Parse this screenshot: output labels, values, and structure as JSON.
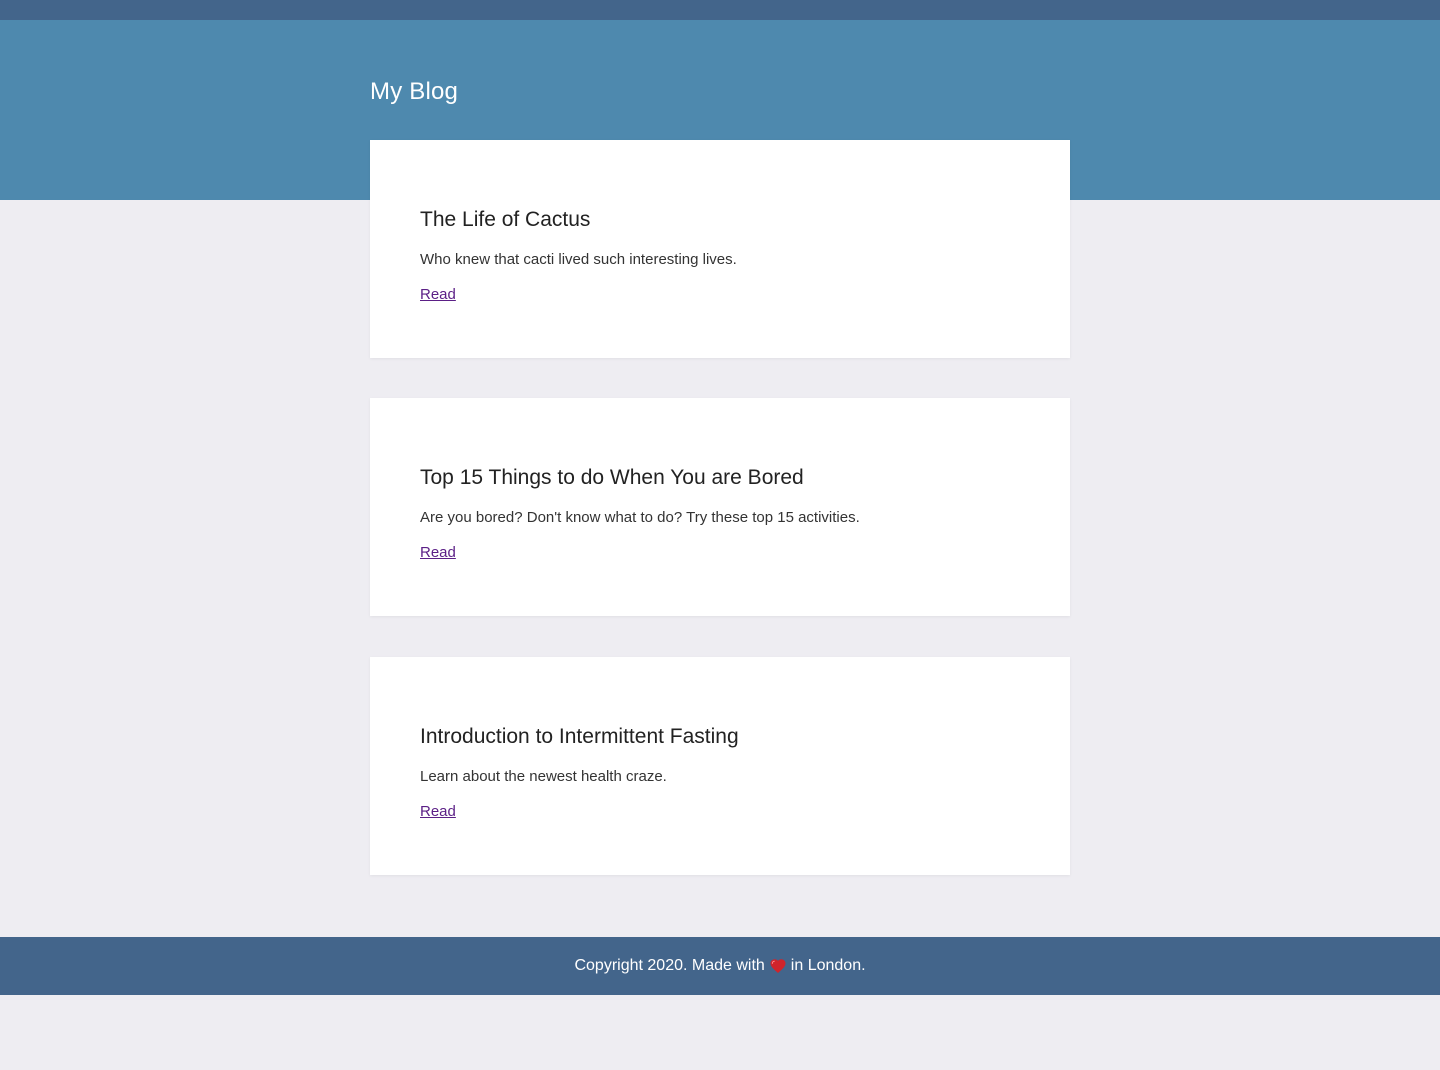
{
  "header": {
    "title": "My Blog"
  },
  "posts": [
    {
      "title": "The Life of Cactus",
      "description": "Who knew that cacti lived such interesting lives.",
      "link_label": "Read"
    },
    {
      "title": "Top 15 Things to do When You are Bored",
      "description": "Are you bored? Don't know what to do? Try these top 15 activities.",
      "link_label": "Read"
    },
    {
      "title": "Introduction to Intermittent Fasting",
      "description": "Learn about the newest health craze.",
      "link_label": "Read"
    }
  ],
  "footer": {
    "text_before": "Copyright 2020. Made with",
    "icon": "heart-icon",
    "text_after": "in London."
  },
  "colors": {
    "topbar": "#43658b",
    "hero": "#4e89ae",
    "background": "#eeedf2",
    "link": "#5b1f86",
    "heart": "#d0242b"
  }
}
